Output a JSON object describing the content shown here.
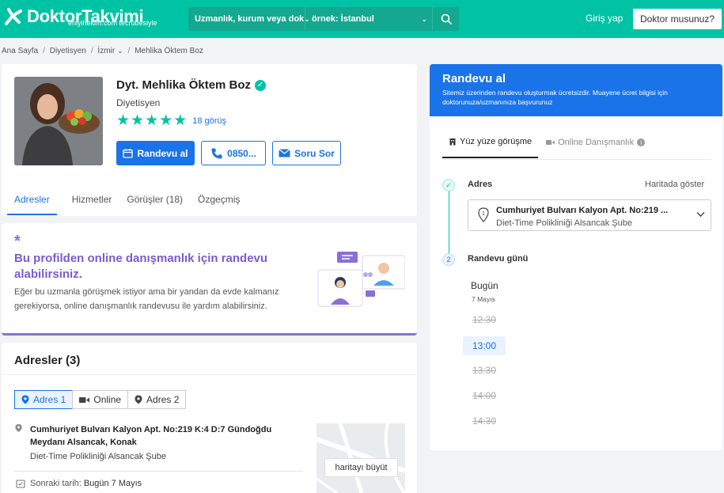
{
  "header": {
    "logo_text": "DoktorTakvimi",
    "logo_sub": "eniyihekim.com tecrübesiyle",
    "search_specialty_placeholder": "Uzmanlık, kurum veya dok",
    "search_location_placeholder": "örnek: İstanbul",
    "login_label": "Giriş yap",
    "doctor_button_label": "Doktor musunuz?"
  },
  "breadcrumb": {
    "items": [
      "Ana Sayfa",
      "Diyetisyen",
      "İzmir",
      "Mehlika Öktem Boz"
    ]
  },
  "profile": {
    "name": "Dyt. Mehlika Öktem Boz",
    "title": "Diyetisyen",
    "rating_stars": 5,
    "review_count": "18 görüş",
    "book_label": "Randevu al",
    "phone_label": "0850...",
    "ask_label": "Soru Sor",
    "tabs": [
      "Adresler",
      "Hizmetler",
      "Görüşler (18)",
      "Özgeçmiş"
    ]
  },
  "promo": {
    "title": "Bu profilden online danışmanlık için randevu alabilirsiniz.",
    "text": "Eğer bu uzmanla görüşmek istiyor ama bir yandan da evde kalmanız gerekiyorsa, online danışmanlık randevusu ile yardım alabilirsiniz."
  },
  "addresses": {
    "title": "Adresler (3)",
    "tabs": [
      "Adres 1",
      "Online",
      "Adres 2"
    ],
    "address_line": "Cumhuriyet Bulvarı Kalyon Apt. No:219 K:4 D:7 Gündoğdu Meydanı Alsancak, Konak",
    "clinic": "Diet-Time Polikliniği Alsancak Şube",
    "next_date_label": "Sonraki tarih:",
    "next_date_value": "Bugün 7 Mayıs",
    "map_button": "haritayı büyüt"
  },
  "appointment": {
    "title": "Randevu al",
    "description": "Sitemiz üzerinden randevu oluşturmak ücretsizdir. Muayene ücret bilgisi için doktorunuza/uzmanınıza başvurunuz",
    "tabs": [
      "Yüz yüze görüşme",
      "Online Danışmanlık"
    ],
    "step1_number": "✓",
    "step1_label": "Adres",
    "map_link": "Haritada göster",
    "select_line1": "Cumhuriyet Bulvarı Kalyon Apt. No:219 ...",
    "select_line2": "Diet-Time Polikliniği Alsancak Şube",
    "step2_number": "2",
    "step2_label": "Randevu günü",
    "day_label": "Bugün",
    "date_label": "7 Mayıs",
    "slots": [
      {
        "time": "12:30",
        "available": false
      },
      {
        "time": "13:00",
        "available": true
      },
      {
        "time": "13:30",
        "available": false
      },
      {
        "time": "14:00",
        "available": false
      },
      {
        "time": "14:30",
        "available": false
      }
    ]
  },
  "colors": {
    "brand": "#00c3a5",
    "primary": "#1a73e8",
    "promo": "#7a5bd0"
  }
}
